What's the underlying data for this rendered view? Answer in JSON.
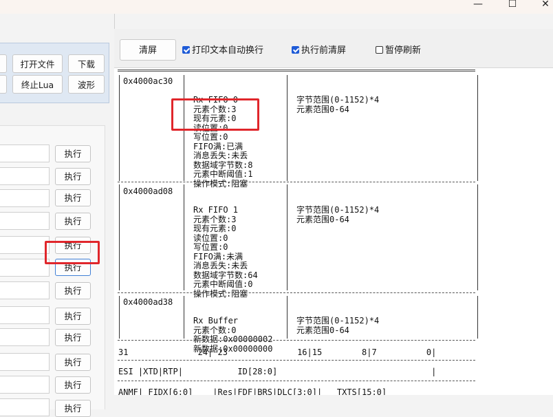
{
  "window": {
    "minimize_glyph": "—",
    "maximize_glyph": "☐",
    "close_glyph": "✕"
  },
  "left": {
    "buttons": {
      "open_file": "打开文件",
      "download": "下载",
      "stop_lua": "终止Lua",
      "waveform": "波形"
    },
    "run_label": "执行"
  },
  "toolbar": {
    "clear_label": "清屏",
    "auto_wrap_label": "打印文本自动换行",
    "auto_wrap_checked": true,
    "clear_before_run_label": "执行前清屏",
    "clear_before_run_checked": true,
    "pause_refresh_label": "暂停刷新",
    "pause_refresh_checked": false
  },
  "console": {
    "fifos": [
      {
        "addr": "0x4000ac30",
        "lines": [
          "Rx FIFO 0",
          "元素个数:3",
          "现有元素:0",
          "读位置:0",
          "写位置:0",
          "FIFO满:已满",
          "消息丢失:未丢",
          "数据域字节数:8",
          "元素中断阈值:1",
          "操作模式:阻塞"
        ],
        "info": [
          "字节范围(0-1152)*4",
          "元素范围0-64"
        ]
      },
      {
        "addr": "0x4000ad08",
        "lines": [
          "Rx FIFO 1",
          "元素个数:3",
          "现有元素:0",
          "读位置:0",
          "写位置:0",
          "FIFO满:未满",
          "消息丢失:未丢",
          "数据域字节数:64",
          "元素中断阈值:0",
          "操作模式:阻塞"
        ],
        "info": [
          "字节范围(0-1152)*4",
          "元素范围0-64"
        ]
      },
      {
        "addr": "0x4000ad38",
        "lines": [
          "Rx Buffer",
          "元素个数:0",
          "新数据:0x00000002",
          "新数据:0x00000000"
        ],
        "info": [
          "字节范围(0-1152)*4",
          "元素范围0-64"
        ]
      }
    ],
    "bit_header": "31              24| 23              16|15        8|7          0|",
    "field_row_1": "ESI |XTD|RTP|           ID[28:0]                               |",
    "field_row_2": "ANMF| FIDX[6:0]    |Res|FDF|BRS|DLC[3:0]|   TXTS[15:0]"
  }
}
